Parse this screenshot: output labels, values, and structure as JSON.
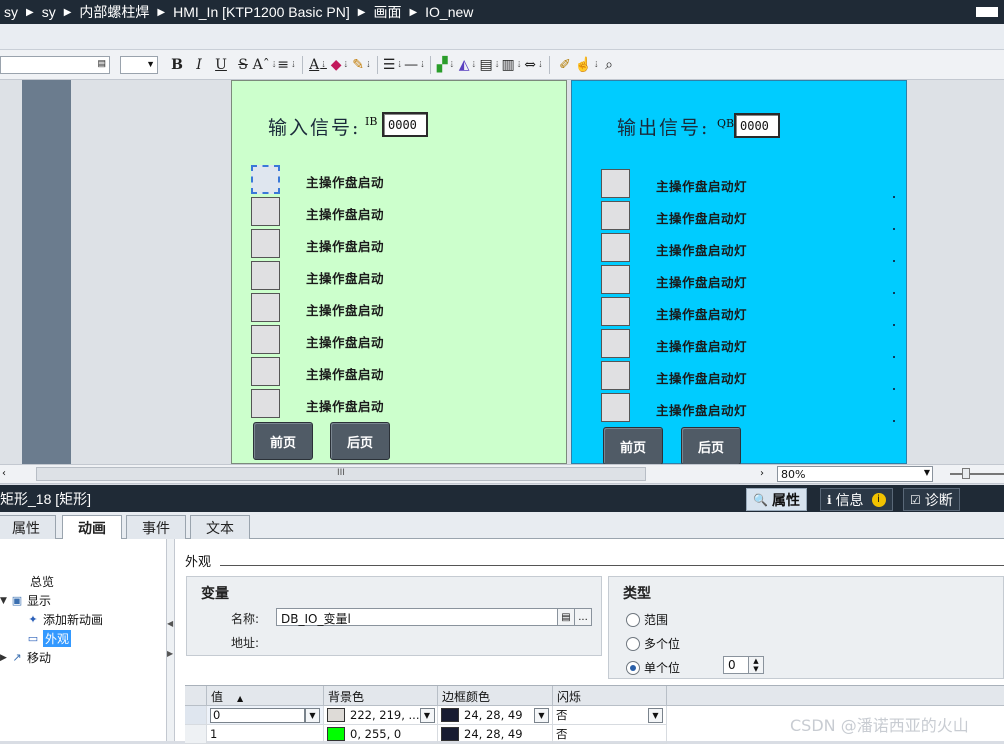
{
  "breadcrumb": [
    "sy",
    "sy",
    "内部螺柱焊",
    "HMI_In [KTP1200 Basic PN]",
    "画面",
    "IO_new"
  ],
  "toolbar": {
    "buttons": [
      "B",
      "I",
      "U",
      "S",
      "A"
    ],
    "icons": [
      "bold-icon",
      "italic-icon",
      "underline-icon",
      "strikethrough-icon",
      "font-size-icon",
      "align-icon",
      "font-color-icon",
      "fill-color-icon",
      "line-color-icon",
      "line-style-icon",
      "line-weight-icon",
      "bring-front-icon",
      "rotate-icon",
      "align-objects-icon",
      "distribute-icon",
      "spacing-icon",
      "format-painter-icon",
      "hand-icon",
      "zoom-icon"
    ]
  },
  "input_panel": {
    "title": "输入信号:",
    "prefix": "IB",
    "value": "0000",
    "rows": [
      "主操作盘启动",
      "主操作盘启动",
      "主操作盘启动",
      "主操作盘启动",
      "主操作盘启动",
      "主操作盘启动",
      "主操作盘启动",
      "主操作盘启动"
    ],
    "prev_button": "前页",
    "next_button": "后页",
    "colors": {
      "background": "#ccffcc"
    }
  },
  "output_panel": {
    "title": "输出信号:",
    "prefix": "QB",
    "value": "0000",
    "rows": [
      "主操作盘启动灯",
      "主操作盘启动灯",
      "主操作盘启动灯",
      "主操作盘启动灯",
      "主操作盘启动灯",
      "主操作盘启动灯",
      "主操作盘启动灯",
      "主操作盘启动灯"
    ],
    "prev_button": "前页",
    "next_button": "后页",
    "colors": {
      "background": "#00ccff"
    }
  },
  "zoom": "80%",
  "scroll_mark": "III",
  "inspector": {
    "object_title": "矩形_18 [矩形]",
    "tabs": [
      "属性",
      "信息",
      "诊断"
    ],
    "sub_tabs": [
      "属性",
      "动画",
      "事件",
      "文本"
    ],
    "tree": {
      "overview": "总览",
      "display": "显示",
      "add_animation": "添加新动画",
      "appearance": "外观",
      "movement": "移动"
    },
    "section_title": "外观",
    "variable": {
      "title": "变量",
      "name_label": "名称:",
      "name_value": "DB_IO_变量l",
      "address_label": "地址:"
    },
    "type": {
      "title": "类型",
      "options": [
        "范围",
        "多个位",
        "单个位"
      ],
      "selected": "单个位",
      "bit_value": "0"
    },
    "table": {
      "headers": [
        "值",
        "背景色",
        "边框颜色",
        "闪烁"
      ],
      "rows": [
        {
          "value": "0",
          "bg": "222, 219, ...",
          "bg_hex": "#dedbd7",
          "border": "24, 28, 49",
          "border_hex": "#181c31",
          "blink": "否"
        },
        {
          "value": "1",
          "bg": "0, 255, 0",
          "bg_hex": "#00ff00",
          "border": "24, 28, 49",
          "border_hex": "#181c31",
          "blink": "否"
        }
      ]
    }
  },
  "watermark": "CSDN @潘诺西亚的火山"
}
